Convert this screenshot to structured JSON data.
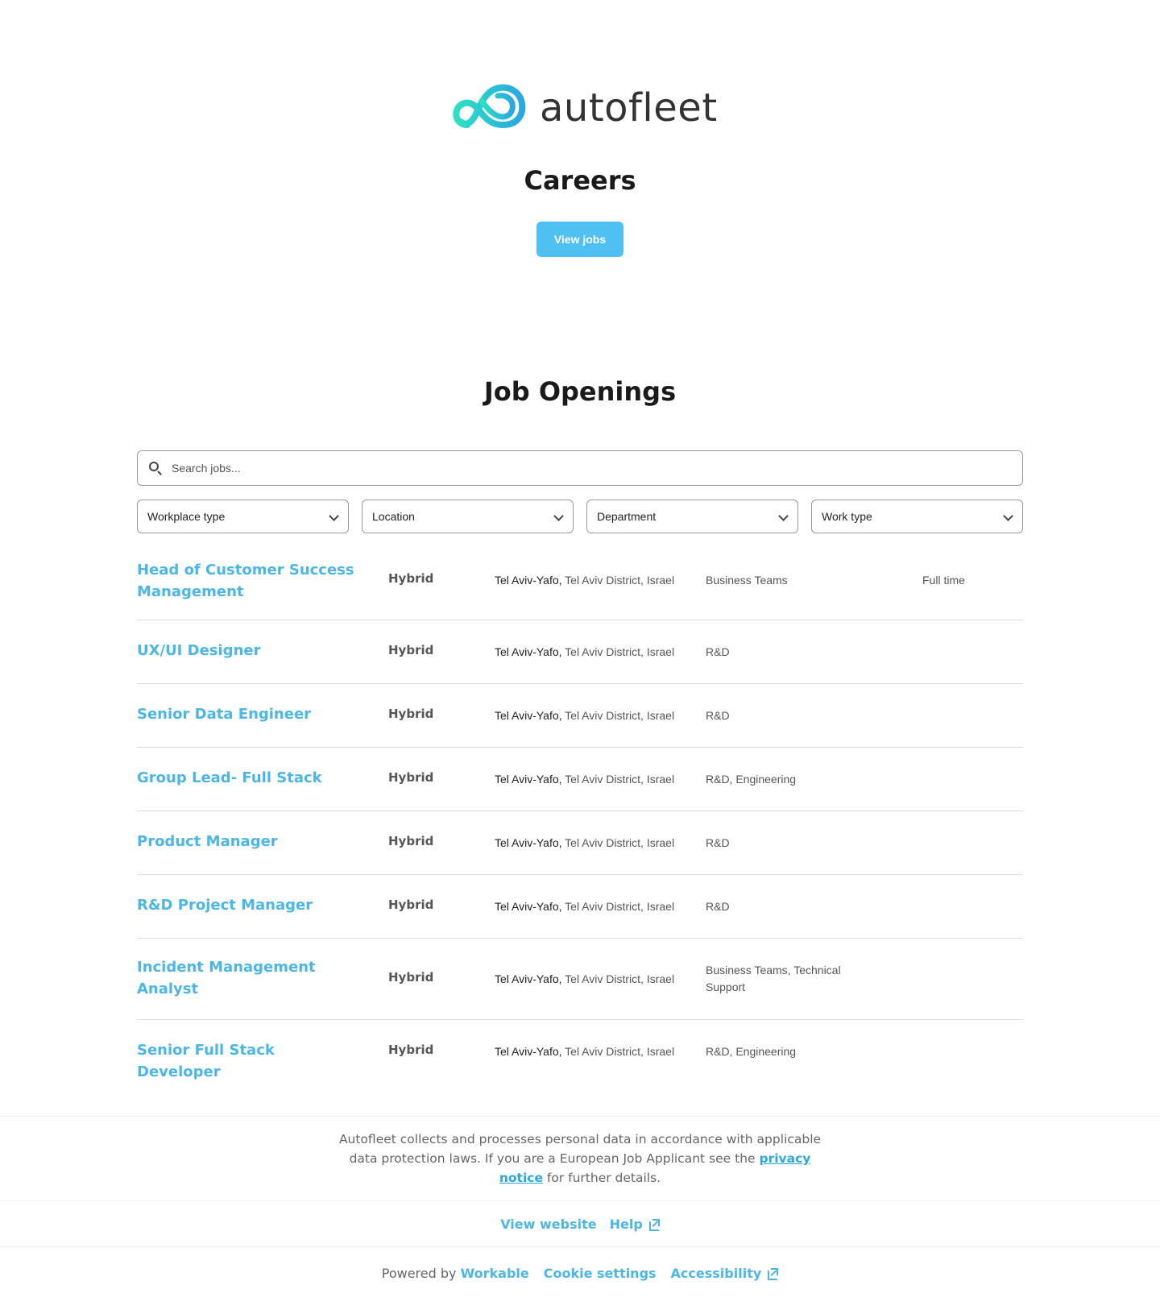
{
  "brand": {
    "logo_text": "autofleet",
    "accent_color": "#4cb6e6",
    "logo_colors": [
      "#2de0c4",
      "#2aa8e0"
    ]
  },
  "hero": {
    "title": "Careers",
    "view_jobs_label": "View jobs"
  },
  "openings": {
    "title": "Job Openings",
    "search_placeholder": "Search jobs...",
    "filters": [
      {
        "label": "Workplace type"
      },
      {
        "label": "Location"
      },
      {
        "label": "Department"
      },
      {
        "label": "Work type"
      }
    ],
    "jobs": [
      {
        "title": "Head of Customer Success Management",
        "workplace": "Hybrid",
        "city": "Tel Aviv-Yafo,",
        "region": " Tel Aviv District, Israel",
        "department": "Business Teams",
        "type": "Full time"
      },
      {
        "title": "UX/UI Designer",
        "workplace": "Hybrid",
        "city": "Tel Aviv-Yafo,",
        "region": " Tel Aviv District, Israel",
        "department": "R&D",
        "type": ""
      },
      {
        "title": "Senior Data Engineer",
        "workplace": "Hybrid",
        "city": "Tel Aviv-Yafo,",
        "region": " Tel Aviv District, Israel",
        "department": "R&D",
        "type": ""
      },
      {
        "title": "Group Lead- Full Stack",
        "workplace": "Hybrid",
        "city": "Tel Aviv-Yafo,",
        "region": " Tel Aviv District, Israel",
        "department": "R&D, Engineering",
        "type": ""
      },
      {
        "title": "Product Manager",
        "workplace": "Hybrid",
        "city": "Tel Aviv-Yafo,",
        "region": " Tel Aviv District, Israel",
        "department": "R&D",
        "type": ""
      },
      {
        "title": "R&D Project Manager",
        "workplace": "Hybrid",
        "city": "Tel Aviv-Yafo,",
        "region": " Tel Aviv District, Israel",
        "department": "R&D",
        "type": ""
      },
      {
        "title": "Incident Management Analyst",
        "workplace": "Hybrid",
        "city": "Tel Aviv-Yafo,",
        "region": " Tel Aviv District, Israel",
        "department": "Business Teams, Technical Support",
        "type": ""
      },
      {
        "title": "Senior Full Stack Developer",
        "workplace": "Hybrid",
        "city": "Tel Aviv-Yafo,",
        "region": " Tel Aviv District, Israel",
        "department": "R&D, Engineering",
        "type": ""
      }
    ]
  },
  "privacy": {
    "text_before": "Autofleet collects and processes personal data in accordance with applicable data protection laws. If you are a European Job Applicant see the ",
    "link_label": "privacy notice",
    "text_after": " for further details."
  },
  "footer_links": {
    "view_website": "View website",
    "help": "Help",
    "help_icon": "external-link-icon"
  },
  "powered": {
    "prefix": "Powered by ",
    "workable": "Workable",
    "cookie_settings": "Cookie settings",
    "accessibility": "Accessibility",
    "accessibility_icon": "external-link-icon"
  }
}
